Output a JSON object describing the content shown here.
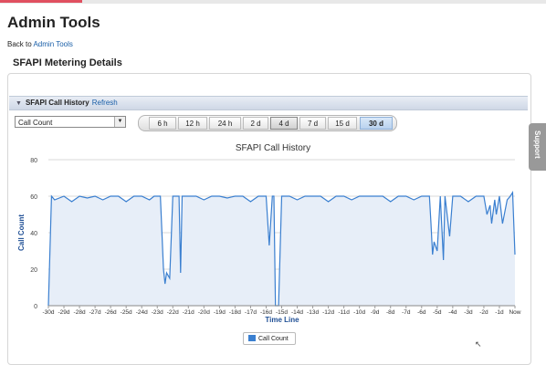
{
  "page": {
    "title": "Admin Tools",
    "back_prefix": "Back to ",
    "back_link": "Admin Tools",
    "section_title": "SFAPI Metering Details",
    "support_label": "Support"
  },
  "panel": {
    "header_title": "SFAPI Call History",
    "refresh_label": "Refresh",
    "metric_select": "Call Count",
    "ranges": [
      "6 h",
      "12 h",
      "24 h",
      "2 d",
      "4 d",
      "7 d",
      "15 d",
      "30 d"
    ],
    "active_range": "30 d"
  },
  "colors": {
    "series": "#3a7fd0",
    "fill": "#e7eef8",
    "link": "#1a5fa8"
  },
  "chart_data": {
    "type": "area",
    "title": "SFAPI Call History",
    "xlabel": "Time Line",
    "ylabel": "Call Count",
    "ylim": [
      0,
      80
    ],
    "yticks": [
      0,
      20,
      40,
      60,
      80
    ],
    "grid": true,
    "legend": "bottom",
    "x_ticks": [
      "-30d",
      "-29d",
      "-28d",
      "-27d",
      "-26d",
      "-25d",
      "-24d",
      "-23d",
      "-22d",
      "-21d",
      "-20d",
      "-19d",
      "-18d",
      "-17d",
      "-16d",
      "-15d",
      "-14d",
      "-13d",
      "-12d",
      "-11d",
      "-10d",
      "-9d",
      "-8d",
      "-7d",
      "-6d",
      "-5d",
      "-4d",
      "-3d",
      "-2d",
      "-1d",
      "Now"
    ],
    "series": [
      {
        "name": "Call Count",
        "x": [
          -30,
          -29.8,
          -29.6,
          -29,
          -28.5,
          -28,
          -27.5,
          -27,
          -26.5,
          -26,
          -25.5,
          -25,
          -24.5,
          -24,
          -23.5,
          -23.2,
          -23,
          -22.8,
          -22.6,
          -22.5,
          -22.4,
          -22.2,
          -22,
          -21.8,
          -21.6,
          -21.5,
          -21.4,
          -21.2,
          -21,
          -20.5,
          -20,
          -19.5,
          -19,
          -18.5,
          -18,
          -17.5,
          -17,
          -16.5,
          -16.2,
          -16,
          -15.8,
          -15.6,
          -15.5,
          -15.4,
          -15.2,
          -15,
          -14.5,
          -14,
          -13.5,
          -13,
          -12.5,
          -12,
          -11.5,
          -11,
          -10.5,
          -10,
          -9.5,
          -9,
          -8.5,
          -8,
          -7.5,
          -7,
          -6.5,
          -6,
          -5.5,
          -5.4,
          -5.3,
          -5.2,
          -5,
          -4.8,
          -4.6,
          -4.5,
          -4.2,
          -4,
          -3.5,
          -3,
          -2.5,
          -2,
          -1.8,
          -1.6,
          -1.5,
          -1.3,
          -1.2,
          -1,
          -0.8,
          -0.5,
          -0.3,
          -0.15,
          0
        ],
        "values": [
          0,
          60,
          58,
          60,
          57,
          60,
          59,
          60,
          58,
          60,
          60,
          57,
          60,
          60,
          58,
          60,
          60,
          60,
          20,
          12,
          18,
          15,
          60,
          60,
          60,
          18,
          60,
          60,
          60,
          60,
          58,
          60,
          60,
          59,
          60,
          60,
          57,
          60,
          60,
          60,
          33,
          60,
          60,
          0,
          0,
          60,
          60,
          58,
          60,
          60,
          60,
          57,
          60,
          60,
          58,
          60,
          60,
          60,
          60,
          57,
          60,
          60,
          58,
          60,
          60,
          45,
          28,
          35,
          30,
          60,
          25,
          60,
          38,
          60,
          60,
          57,
          60,
          60,
          50,
          55,
          45,
          58,
          50,
          60,
          45,
          58,
          60,
          62,
          28
        ]
      }
    ]
  }
}
